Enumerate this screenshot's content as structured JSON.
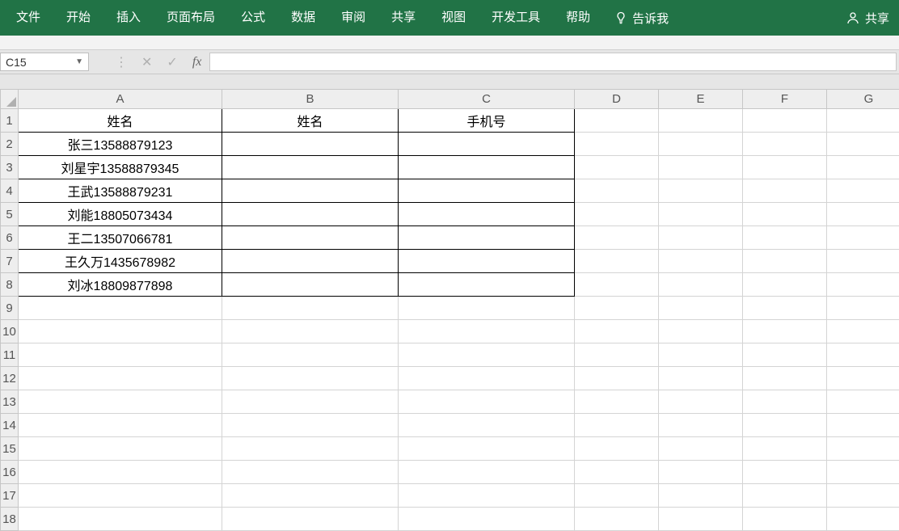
{
  "ribbon": {
    "tabs": [
      "文件",
      "开始",
      "插入",
      "页面布局",
      "公式",
      "数据",
      "审阅",
      "共享",
      "视图",
      "开发工具",
      "帮助"
    ],
    "tell_me": "告诉我",
    "share": "共享"
  },
  "formula_bar": {
    "name_box": "C15",
    "fx_label": "fx",
    "formula_value": ""
  },
  "columns": [
    "A",
    "B",
    "C",
    "D",
    "E",
    "F",
    "G"
  ],
  "row_count": 18,
  "data_region": {
    "rows": 8,
    "cols": 3
  },
  "cells": {
    "r1": {
      "A": "姓名",
      "B": "姓名",
      "C": "手机号"
    },
    "r2": {
      "A": "张三13588879123",
      "B": "",
      "C": ""
    },
    "r3": {
      "A": "刘星宇13588879345",
      "B": "",
      "C": ""
    },
    "r4": {
      "A": "王武13588879231",
      "B": "",
      "C": ""
    },
    "r5": {
      "A": "刘能18805073434",
      "B": "",
      "C": ""
    },
    "r6": {
      "A": "王二13507066781",
      "B": "",
      "C": ""
    },
    "r7": {
      "A": "王久万1435678982",
      "B": "",
      "C": ""
    },
    "r8": {
      "A": "刘冰18809877898",
      "B": "",
      "C": ""
    }
  }
}
